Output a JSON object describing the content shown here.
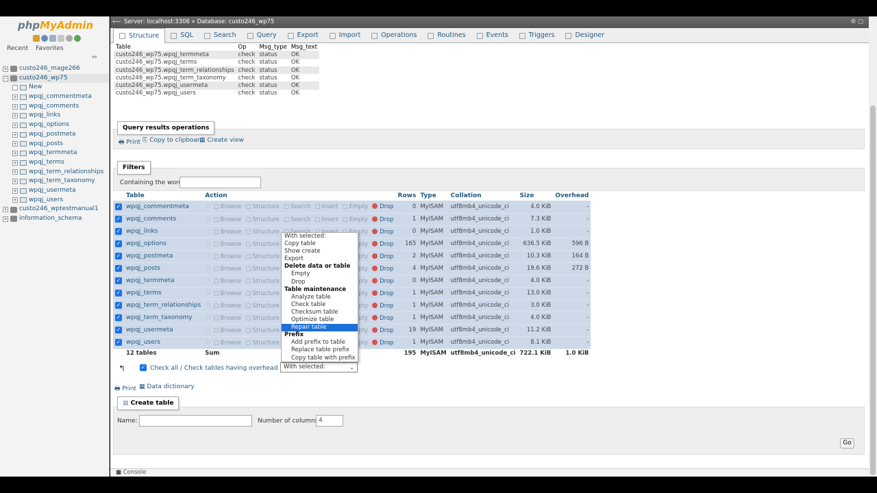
{
  "logo": {
    "php": "php",
    "myadmin": "MyAdmin"
  },
  "nav": {
    "tabs": [
      "Recent",
      "Favorites"
    ],
    "collapse": "⇔",
    "tree": [
      {
        "label": "custo246_mage266",
        "level": 0,
        "kind": "db"
      },
      {
        "label": "custo246_wp75",
        "level": 0,
        "kind": "db"
      },
      {
        "label": "New",
        "level": 1,
        "kind": "new"
      },
      {
        "label": "wpqj_commentmeta",
        "level": 1,
        "kind": "table"
      },
      {
        "label": "wpqj_comments",
        "level": 1,
        "kind": "table"
      },
      {
        "label": "wpqj_links",
        "level": 1,
        "kind": "table"
      },
      {
        "label": "wpqj_options",
        "level": 1,
        "kind": "table"
      },
      {
        "label": "wpqj_postmeta",
        "level": 1,
        "kind": "table"
      },
      {
        "label": "wpqj_posts",
        "level": 1,
        "kind": "table"
      },
      {
        "label": "wpqj_termmeta",
        "level": 1,
        "kind": "table"
      },
      {
        "label": "wpqj_terms",
        "level": 1,
        "kind": "table"
      },
      {
        "label": "wpqj_term_relationships",
        "level": 1,
        "kind": "table"
      },
      {
        "label": "wpqj_term_taxonomy",
        "level": 1,
        "kind": "table"
      },
      {
        "label": "wpqj_usermeta",
        "level": 1,
        "kind": "table"
      },
      {
        "label": "wpqj_users",
        "level": 1,
        "kind": "table"
      },
      {
        "label": "custo246_wptestmanual1",
        "level": 0,
        "kind": "db"
      },
      {
        "label": "information_schema",
        "level": 0,
        "kind": "db"
      }
    ]
  },
  "breadcrumb": {
    "server": "Server: localhost:3306",
    "sep": "»",
    "database": "Database: custo246_wp75"
  },
  "tabs": [
    "Structure",
    "SQL",
    "Search",
    "Query",
    "Export",
    "Import",
    "Operations",
    "Routines",
    "Events",
    "Triggers",
    "Designer"
  ],
  "check_results": {
    "headers": [
      "Table",
      "Op",
      "Msg_type",
      "Msg_text"
    ],
    "rows": [
      [
        "custo246_wp75.wpqj_termmeta",
        "check",
        "status",
        "OK"
      ],
      [
        "custo246_wp75.wpqj_terms",
        "check",
        "status",
        "OK"
      ],
      [
        "custo246_wp75.wpqj_term_relationships",
        "check",
        "status",
        "OK"
      ],
      [
        "custo246_wp75.wpqj_term_taxonomy",
        "check",
        "status",
        "OK"
      ],
      [
        "custo246_wp75.wpqj_usermeta",
        "check",
        "status",
        "OK"
      ],
      [
        "custo246_wp75.wpqj_users",
        "check",
        "status",
        "OK"
      ]
    ]
  },
  "query_ops": {
    "legend": "Query results operations",
    "print": "Print",
    "copy": "Copy to clipboard",
    "view": "Create view"
  },
  "filters": {
    "legend": "Filters",
    "label": "Containing the word:",
    "value": ""
  },
  "db_table": {
    "headers": {
      "table": "Table",
      "action": "Action",
      "rows": "Rows",
      "type": "Type",
      "collation": "Collation",
      "size": "Size",
      "overhead": "Overhead"
    },
    "actions": [
      "Browse",
      "Structure",
      "Search",
      "Insert",
      "Empty",
      "Drop"
    ],
    "rows": [
      {
        "name": "wpqj_commentmeta",
        "rows": "0",
        "type": "MyISAM",
        "collation": "utf8mb4_unicode_ci",
        "size": "4.0 KiB",
        "overhead": "-"
      },
      {
        "name": "wpqj_comments",
        "rows": "1",
        "type": "MyISAM",
        "collation": "utf8mb4_unicode_ci",
        "size": "7.3 KiB",
        "overhead": "-"
      },
      {
        "name": "wpqj_links",
        "rows": "0",
        "type": "MyISAM",
        "collation": "utf8mb4_unicode_ci",
        "size": "1.0 KiB",
        "overhead": "-"
      },
      {
        "name": "wpqj_options",
        "rows": "165",
        "type": "MyISAM",
        "collation": "utf8mb4_unicode_ci",
        "size": "636.5 KiB",
        "overhead": "596 B"
      },
      {
        "name": "wpqj_postmeta",
        "rows": "2",
        "type": "MyISAM",
        "collation": "utf8mb4_unicode_ci",
        "size": "10.3 KiB",
        "overhead": "164 B"
      },
      {
        "name": "wpqj_posts",
        "rows": "4",
        "type": "MyISAM",
        "collation": "utf8mb4_unicode_ci",
        "size": "19.6 KiB",
        "overhead": "272 B"
      },
      {
        "name": "wpqj_termmeta",
        "rows": "0",
        "type": "MyISAM",
        "collation": "utf8mb4_unicode_ci",
        "size": "4.0 KiB",
        "overhead": "-"
      },
      {
        "name": "wpqj_terms",
        "rows": "1",
        "type": "MyISAM",
        "collation": "utf8mb4_unicode_ci",
        "size": "13.0 KiB",
        "overhead": "-"
      },
      {
        "name": "wpqj_term_relationships",
        "rows": "1",
        "type": "MyISAM",
        "collation": "utf8mb4_unicode_ci",
        "size": "3.0 KiB",
        "overhead": "-"
      },
      {
        "name": "wpqj_term_taxonomy",
        "rows": "1",
        "type": "MyISAM",
        "collation": "utf8mb4_unicode_ci",
        "size": "4.0 KiB",
        "overhead": "-"
      },
      {
        "name": "wpqj_usermeta",
        "rows": "19",
        "type": "MyISAM",
        "collation": "utf8mb4_unicode_ci",
        "size": "11.2 KiB",
        "overhead": "-"
      },
      {
        "name": "wpqj_users",
        "rows": "1",
        "type": "MyISAM",
        "collation": "utf8mb4_unicode_ci",
        "size": "8.1 KiB",
        "overhead": "-"
      }
    ],
    "sum": {
      "count": "12 tables",
      "label": "Sum",
      "rows": "195",
      "type": "MyISAM",
      "collation": "utf8mb4_unicode_ci",
      "size": "722.1 KiB",
      "overhead": "1.0 KiB"
    }
  },
  "check_all": {
    "label": "Check all / Check tables having overhead"
  },
  "with_selected": {
    "value": "With selected:",
    "menu": [
      {
        "label": "With selected:",
        "kind": "item"
      },
      {
        "label": "Copy table",
        "kind": "item"
      },
      {
        "label": "Show create",
        "kind": "item"
      },
      {
        "label": "Export",
        "kind": "item"
      },
      {
        "label": "Delete data or table",
        "kind": "grp"
      },
      {
        "label": "Empty",
        "kind": "sub"
      },
      {
        "label": "Drop",
        "kind": "sub"
      },
      {
        "label": "Table maintenance",
        "kind": "grp"
      },
      {
        "label": "Analyze table",
        "kind": "sub"
      },
      {
        "label": "Check table",
        "kind": "sub"
      },
      {
        "label": "Checksum table",
        "kind": "sub"
      },
      {
        "label": "Optimize table",
        "kind": "sub"
      },
      {
        "label": "Repair table",
        "kind": "sub",
        "highlight": true
      },
      {
        "label": "Prefix",
        "kind": "grp"
      },
      {
        "label": "Add prefix to table",
        "kind": "sub"
      },
      {
        "label": "Replace table prefix",
        "kind": "sub"
      },
      {
        "label": "Copy table with prefix",
        "kind": "sub"
      }
    ]
  },
  "bottom_links": {
    "print": "Print",
    "dict": "Data dictionary"
  },
  "create_table": {
    "legend": "Create table",
    "name_label": "Name:",
    "name_value": "",
    "cols_label": "Number of columns:",
    "cols_value": "4",
    "go": "Go"
  },
  "console": {
    "label": "Console"
  }
}
